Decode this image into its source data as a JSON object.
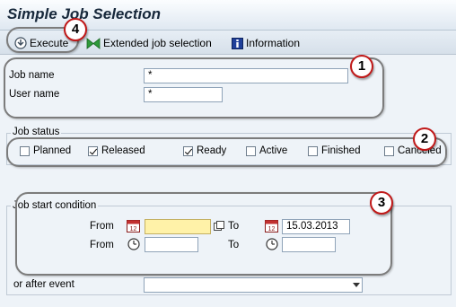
{
  "title": "Simple Job Selection",
  "toolbar": {
    "execute": "Execute",
    "extended": "Extended job selection",
    "information": "Information"
  },
  "job_fields": {
    "job_name_label": "Job name",
    "job_name_value": "*",
    "user_name_label": "User name",
    "user_name_value": "*"
  },
  "job_status": {
    "heading": "Job status",
    "items": [
      {
        "label": "Planned",
        "checked": false
      },
      {
        "label": "Released",
        "checked": true
      },
      {
        "label": "Ready",
        "checked": true
      },
      {
        "label": "Active",
        "checked": false
      },
      {
        "label": "Finished",
        "checked": false
      },
      {
        "label": "Canceled",
        "checked": false
      }
    ]
  },
  "start_condition": {
    "heading": "Job start condition",
    "from_label": "From",
    "to_label": "To",
    "date_from": "",
    "date_to": "15.03.2013",
    "time_from": "",
    "time_to": "",
    "after_event_label": "or after event",
    "after_event_value": ""
  },
  "callouts": [
    "1",
    "2",
    "3",
    "4"
  ],
  "colors": {
    "callout_ring": "#c01818",
    "highlight": "#7c7c7c",
    "required_field": "#fff2a8"
  }
}
